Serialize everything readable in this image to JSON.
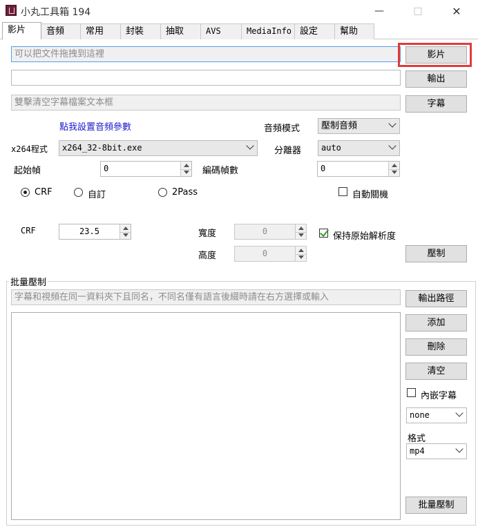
{
  "window": {
    "title": "小丸工具箱 194",
    "minimize_glyph": "—",
    "maximize_glyph": "□",
    "close_glyph": "✕"
  },
  "tabs": [
    {
      "label": "影片"
    },
    {
      "label": "音頻"
    },
    {
      "label": "常用"
    },
    {
      "label": "封裝"
    },
    {
      "label": "抽取"
    },
    {
      "label": "AVS"
    },
    {
      "label": "MediaInfo"
    },
    {
      "label": "設定"
    },
    {
      "label": "幫助"
    }
  ],
  "video": {
    "input_placeholder": "可以把文件拖拽到這裡",
    "input_button": "影片",
    "output_value": "",
    "output_button": "輸出",
    "subtitle_placeholder": "雙擊清空字幕檔案文本框",
    "subtitle_button": "字幕",
    "audio_settings_link": "點我設置音頻參數",
    "audio_mode_label": "音頻模式",
    "audio_mode_value": "壓制音頻",
    "x264_label": "x264程式",
    "x264_value": "x264_32-8bit.exe",
    "demuxer_label": "分離器",
    "demuxer_value": "auto",
    "start_frame_label": "起始幀",
    "start_frame_value": "0",
    "encode_frames_label": "編碼幀數",
    "encode_frames_value": "0",
    "mode_crf": "CRF",
    "mode_custom": "自訂",
    "mode_2pass": "2Pass",
    "auto_shutdown": "自動關機",
    "crf_label": "CRF",
    "crf_value": "23.5",
    "width_label": "寬度",
    "width_value": "0",
    "height_label": "高度",
    "height_value": "0",
    "keep_resolution": "保持原始解析度",
    "encode_button": "壓制"
  },
  "batch": {
    "group_title": "批量壓制",
    "hint_placeholder": "字幕和視頻在同一資料夾下且同名，不同名僅有語言後綴時請在右方選擇或輸入",
    "output_path_button": "輸出路徑",
    "add_button": "添加",
    "delete_button": "刪除",
    "clear_button": "清空",
    "embed_subtitle": "內嵌字幕",
    "subtitle_suffix_value": "none",
    "format_label": "格式",
    "format_value": "mp4",
    "batch_encode_button": "批量壓制"
  }
}
